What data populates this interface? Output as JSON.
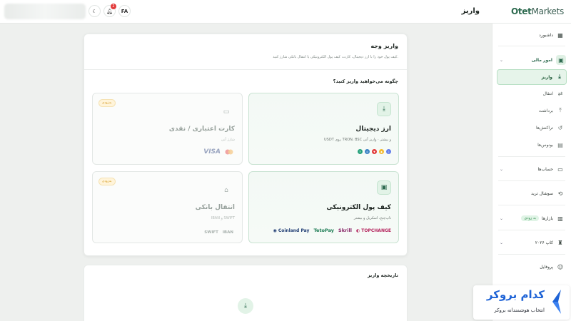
{
  "topbar": {
    "page_title": "واریز",
    "lang": "FA",
    "notif_count": "2",
    "brand_a": "Otet",
    "brand_b": "Markets"
  },
  "sidebar": {
    "items": [
      {
        "label": "داشبورد",
        "icon": "grid-icon"
      },
      {
        "label": "امور مالی",
        "icon": "wallet-icon"
      },
      {
        "label": "واریز",
        "icon": "download-icon"
      },
      {
        "label": "انتقال",
        "icon": "transfer-icon"
      },
      {
        "label": "برداشت",
        "icon": "upload-icon"
      },
      {
        "label": "تراکنش‌ها",
        "icon": "history-icon"
      },
      {
        "label": "بونوس‌ها",
        "icon": "gift-icon"
      },
      {
        "label": "حساب‌ها",
        "icon": "card-icon"
      },
      {
        "label": "سوشال ترید",
        "icon": "social-icon"
      },
      {
        "label": "بازارها",
        "icon": "chart-icon",
        "badge": "به زودی"
      },
      {
        "label": "کاپ ۲۰۲۶",
        "icon": "cup-icon"
      },
      {
        "label": "پروفایل",
        "icon": "user-icon"
      }
    ]
  },
  "deposit": {
    "title": "واریز وجه",
    "subtitle": "کیف پول خود را با ارز دیجیتال، کارت، کیف پول الکترونیکی یا انتقال بانکی شارژ کنید.",
    "question": "چگونه می‌خواهید واریز کنید؟",
    "options": {
      "crypto": {
        "title": "ارز دیجیتال",
        "desc": "USDT روی TRON، BSC و بیشتر · واریز آنی"
      },
      "card": {
        "title": "کارت اعتباری / نقدی",
        "desc": "شارژ آنی",
        "badge": "به‌زودی",
        "visa": "VISA"
      },
      "ewallet": {
        "title": "کیف پول الکترونیکی",
        "desc": "تاپ‌چنج، اسکریل و بیشتر",
        "logos": [
          "Coinland Pay",
          "TetoPay",
          "Skrill",
          "TOPCHANGE"
        ]
      },
      "bank": {
        "title": "انتقال بانکی",
        "desc": "IBAN و SWIFT",
        "badge": "به‌زودی",
        "logos": [
          "SWIFT",
          "IBAN"
        ]
      }
    }
  },
  "history": {
    "title": "تاریخچه واریز"
  },
  "overlay": {
    "name": "کدام بروکر",
    "tagline": "انتخاب هوشمندانه بروکر"
  },
  "colors": {
    "accent": "#2d6a4f",
    "accent_light": "#e2f3e7",
    "soon": "#d49a21"
  }
}
